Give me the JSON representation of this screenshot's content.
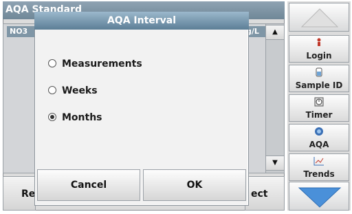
{
  "background": {
    "title": "AQA Standard",
    "column1": "NO3",
    "column2": "g/L",
    "bottom_left_btn_partial": "Re",
    "bottom_right_btn_partial": "ect"
  },
  "sidebar": {
    "items": [
      {
        "label": "Login",
        "icon": "person-icon"
      },
      {
        "label": "Sample ID",
        "icon": "sample-vial-icon"
      },
      {
        "label": "Timer",
        "icon": "timer-icon"
      },
      {
        "label": "AQA",
        "icon": "aqa-icon"
      },
      {
        "label": "Trends",
        "icon": "trends-icon"
      }
    ]
  },
  "dialog": {
    "title": "AQA Interval",
    "options": [
      {
        "label": "Measurements",
        "selected": false
      },
      {
        "label": "Weeks",
        "selected": false
      },
      {
        "label": "Months",
        "selected": true
      }
    ],
    "cancel_label": "Cancel",
    "ok_label": "OK"
  },
  "colors": {
    "title_bar": "#6f8797",
    "dialog_title": "#5c7e96",
    "nav_arrow": "#4a90d9"
  }
}
